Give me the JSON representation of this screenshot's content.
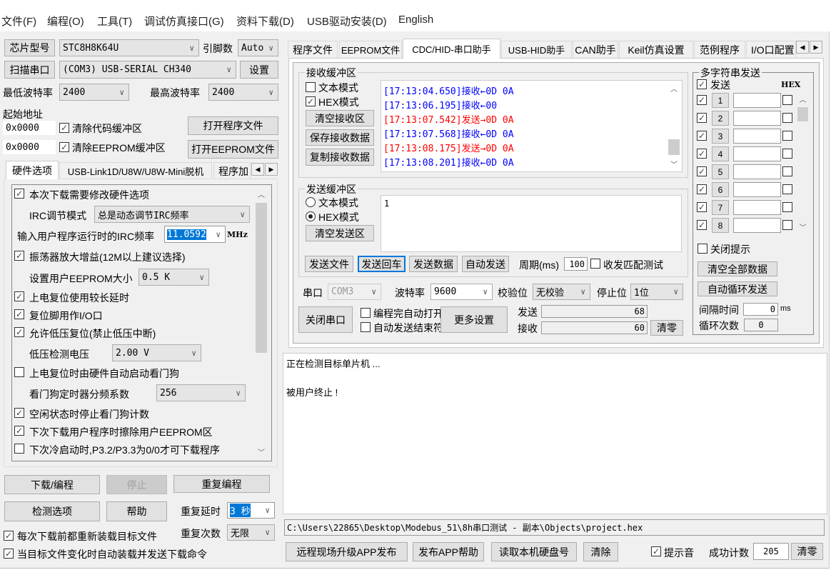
{
  "menu": [
    "文件(F)",
    "编程(O)",
    "工具(T)",
    "调试仿真接口(G)",
    "资料下载(D)",
    "USB驱动安装(D)",
    "English"
  ],
  "left": {
    "chip_button": "芯片型号",
    "chip_value": "STC8H8K64U",
    "pins_label": "引脚数",
    "pins_value": "Auto",
    "scan_button": "扫描串口",
    "port_value": "(COM3) USB-SERIAL CH340",
    "settings_button": "设置",
    "min_baud_label": "最低波特率",
    "min_baud": "2400",
    "max_baud_label": "最高波特率",
    "max_baud": "2400",
    "start_addr_label": "起始地址",
    "addr1": "0x0000",
    "clear_code": "清除代码缓冲区",
    "addr2": "0x0000",
    "clear_eeprom": "清除EEPROM缓冲区",
    "open_program": "打开程序文件",
    "open_eeprom": "打开EEPROM文件",
    "tabs": [
      "硬件选项",
      "USB-Link1D/U8W/U8W-Mini脱机",
      "程序加"
    ],
    "options": [
      {
        "type": "check",
        "checked": true,
        "label": "本次下载需要修改硬件选项"
      },
      {
        "type": "select",
        "label": "IRC调节模式",
        "value": "总是动态调节IRC频率"
      },
      {
        "type": "freq",
        "label": "输入用户程序运行时的IRC频率",
        "value": "11.0592",
        "unit": "MHz"
      },
      {
        "type": "check",
        "checked": true,
        "label": "振荡器放大增益(12M以上建议选择)"
      },
      {
        "type": "select",
        "label": "设置用户EEPROM大小",
        "value": "0.5 K"
      },
      {
        "type": "check",
        "checked": true,
        "label": "上电复位使用较长延时"
      },
      {
        "type": "check",
        "checked": true,
        "label": "复位脚用作I/O口"
      },
      {
        "type": "check",
        "checked": true,
        "label": "允许低压复位(禁止低压中断)"
      },
      {
        "type": "select",
        "label": "低压检测电压",
        "value": "2.00 V"
      },
      {
        "type": "check",
        "checked": false,
        "label": "上电复位时由硬件自动启动看门狗"
      },
      {
        "type": "select",
        "label": "看门狗定时器分频系数",
        "value": "256"
      },
      {
        "type": "check",
        "checked": true,
        "label": "空闲状态时停止看门狗计数"
      },
      {
        "type": "check",
        "checked": true,
        "label": "下次下载用户程序时擦除用户EEPROM区"
      },
      {
        "type": "check",
        "checked": false,
        "label": "下次冷启动时,P3.2/P3.3为0/0才可下载程序"
      }
    ],
    "download": "下载/编程",
    "stop": "停止",
    "repeat_program": "重复编程",
    "detect": "检测选项",
    "help": "帮助",
    "repeat_delay_label": "重复延时",
    "repeat_delay": "3 秒",
    "repeat_count_label": "重复次数",
    "repeat_count": "无限",
    "reload_each": "每次下载前都重新装载目标文件",
    "auto_reload": "当目标文件变化时自动装载并发送下载命令"
  },
  "right": {
    "tabs": [
      "程序文件",
      "EEPROM文件",
      "CDC/HID-串口助手",
      "USB-HID助手",
      "CAN助手",
      "Keil仿真设置",
      "范例程序",
      "I/O口配置"
    ],
    "recv": {
      "title": "接收缓冲区",
      "text_mode": "文本模式",
      "hex_mode": "HEX模式",
      "clear": "清空接收区",
      "save": "保存接收数据",
      "copy": "复制接收数据",
      "lines": [
        {
          "text": "[17:13:04.650]接收←0D 0A",
          "color": "#0000ff"
        },
        {
          "text": "[17:13:06.195]接收←00",
          "color": "#0000ff"
        },
        {
          "text": "[17:13:07.542]发送→0D 0A",
          "color": "#ff0000"
        },
        {
          "text": "[17:13:07.568]接收←0D 0A",
          "color": "#0000ff"
        },
        {
          "text": "[17:13:08.175]发送→0D 0A",
          "color": "#ff0000"
        },
        {
          "text": "[17:13:08.201]接收←0D 0A",
          "color": "#0000ff"
        }
      ]
    },
    "send": {
      "title": "发送缓冲区",
      "text_mode": "文本模式",
      "hex_mode": "HEX模式",
      "clear": "清空发送区",
      "content": "1",
      "send_file": "发送文件",
      "send_enter": "发送回车",
      "send_data": "发送数据",
      "auto_send": "自动发送",
      "period_label": "周期(ms)",
      "period": "100",
      "match_test": "收发匹配测试"
    },
    "port_label": "串口",
    "port": "COM3",
    "baud_label": "波特率",
    "baud": "9600",
    "parity_label": "校验位",
    "parity": "无校验",
    "stop_label": "停止位",
    "stop": "1位",
    "close_port": "关闭串口",
    "auto_open": "编程完自动打开",
    "auto_end": "自动发送结束符",
    "more": "更多设置",
    "sent_label": "发送",
    "sent": "68",
    "recv_label": "接收",
    "recv_count": "60",
    "clear_counts": "清零",
    "multi": {
      "title": "多字符串发送",
      "send_label": "发送",
      "hex_label": "HEX",
      "rows": [
        "1",
        "2",
        "3",
        "4",
        "5",
        "6",
        "7",
        "8"
      ],
      "close_hint": "关闭提示",
      "clear_all": "清空全部数据",
      "auto_loop": "自动循环发送",
      "interval_label": "间隔时间",
      "interval": "0",
      "ms": "ms",
      "loop_label": "循环次数",
      "loop": "0"
    }
  },
  "log": [
    "正在检测目标单片机 ...",
    "",
    "被用户终止 !"
  ],
  "path": "C:\\Users\\22865\\Desktop\\Modebus_51\\8h串口测试 - 副本\\Objects\\project.hex",
  "bottom": {
    "remote": "远程现场升级APP发布",
    "publish_help": "发布APP帮助",
    "read_disk": "读取本机硬盘号",
    "clear": "清除",
    "sound": "提示音",
    "success_label": "成功计数",
    "success": "205",
    "reset": "清零"
  }
}
